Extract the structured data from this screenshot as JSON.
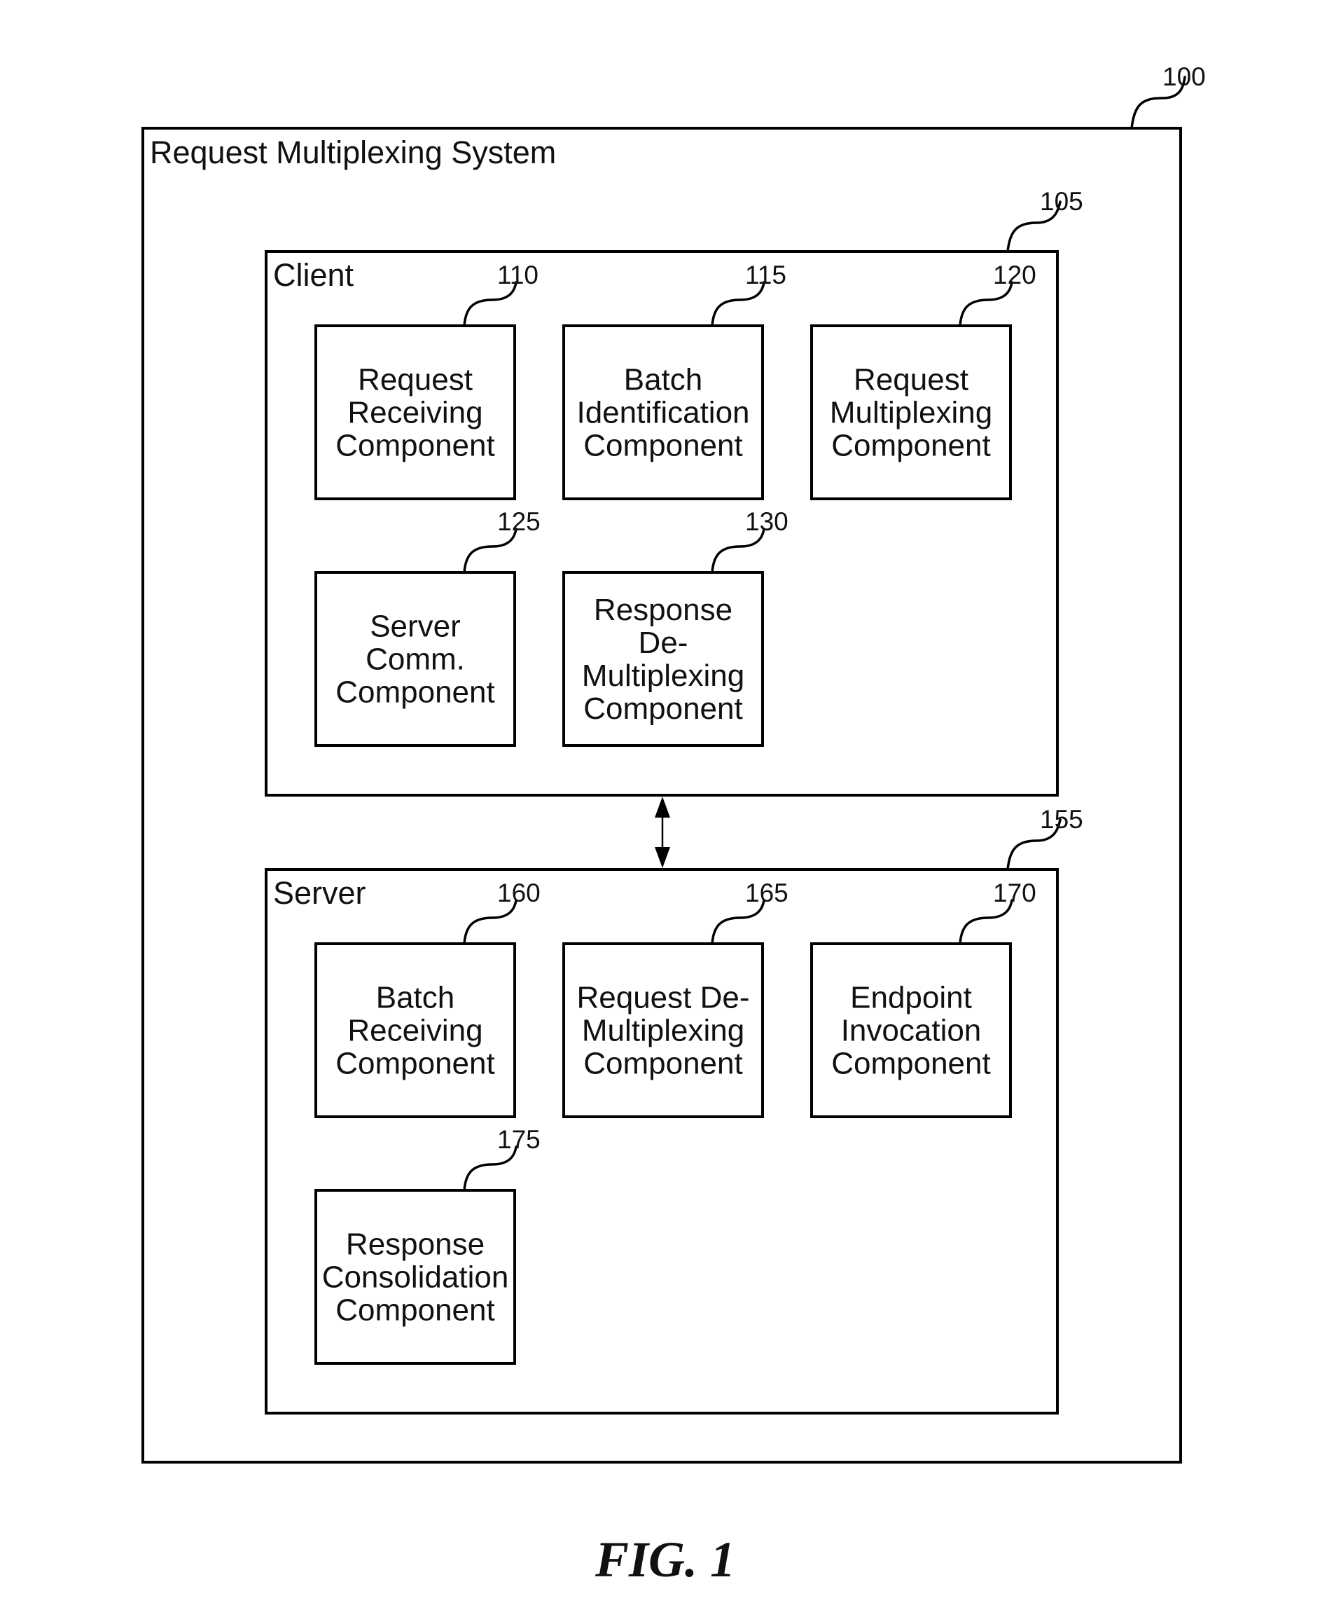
{
  "figure": {
    "caption": "FIG. 1"
  },
  "system": {
    "title": "Request Multiplexing System",
    "ref": "100"
  },
  "client": {
    "title": "Client",
    "ref": "105",
    "components": [
      {
        "ref": "110",
        "lines": [
          "Request",
          "Receiving",
          "Component"
        ]
      },
      {
        "ref": "115",
        "lines": [
          "Batch",
          "Identification",
          "Component"
        ]
      },
      {
        "ref": "120",
        "lines": [
          "Request",
          "Multiplexing",
          "Component"
        ]
      },
      {
        "ref": "125",
        "lines": [
          "Server",
          "Comm.",
          "Component"
        ]
      },
      {
        "ref": "130",
        "lines": [
          "Response",
          "De-",
          "Multiplexing",
          "Component"
        ]
      }
    ]
  },
  "server": {
    "title": "Server",
    "ref": "155",
    "components": [
      {
        "ref": "160",
        "lines": [
          "Batch",
          "Receiving",
          "Component"
        ]
      },
      {
        "ref": "165",
        "lines": [
          "Request De-",
          "Multiplexing",
          "Component"
        ]
      },
      {
        "ref": "170",
        "lines": [
          "Endpoint",
          "Invocation",
          "Component"
        ]
      },
      {
        "ref": "175",
        "lines": [
          "Response",
          "Consolidation",
          "Component"
        ]
      }
    ]
  },
  "connection": {
    "type": "bidirectional-arrow",
    "from": "Client",
    "to": "Server"
  }
}
